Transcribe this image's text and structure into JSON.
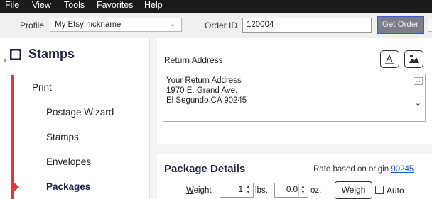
{
  "menu": {
    "items": [
      "File",
      "View",
      "Tools",
      "Favorites",
      "Help"
    ]
  },
  "toolbar": {
    "profile_label": "Profile",
    "profile_value": "My Etsy nickname",
    "order_id_label": "Order ID",
    "order_id_value": "120004",
    "get_order_label": "Get Order"
  },
  "sidebar": {
    "brand": "Stamps",
    "items": [
      {
        "label": "Print"
      },
      {
        "label": "Postage Wizard"
      },
      {
        "label": "Stamps"
      },
      {
        "label": "Envelopes"
      },
      {
        "label": "Packages"
      }
    ],
    "active_item": "Packages",
    "accent_color": "#e13a33"
  },
  "return_address": {
    "title_first": "R",
    "title_rest": "eturn Address",
    "lines": [
      "Your Return Address",
      "1970 E. Grand Ave.",
      "El Segundo CA 90245"
    ],
    "more_label": "..."
  },
  "package": {
    "title": "Package Details",
    "rate_text": "Rate based on origin",
    "origin_zip": "90245",
    "weight_label_first": "W",
    "weight_label_rest": "eight",
    "lbs_value": "1",
    "lbs_unit": "lbs.",
    "oz_value": "0.0",
    "oz_unit": "oz.",
    "weigh_label": "Weigh",
    "auto_label": "Auto",
    "auto_checked": false
  },
  "colors": {
    "focus_outline": "#3f57d8",
    "link": "#1a55c8"
  }
}
